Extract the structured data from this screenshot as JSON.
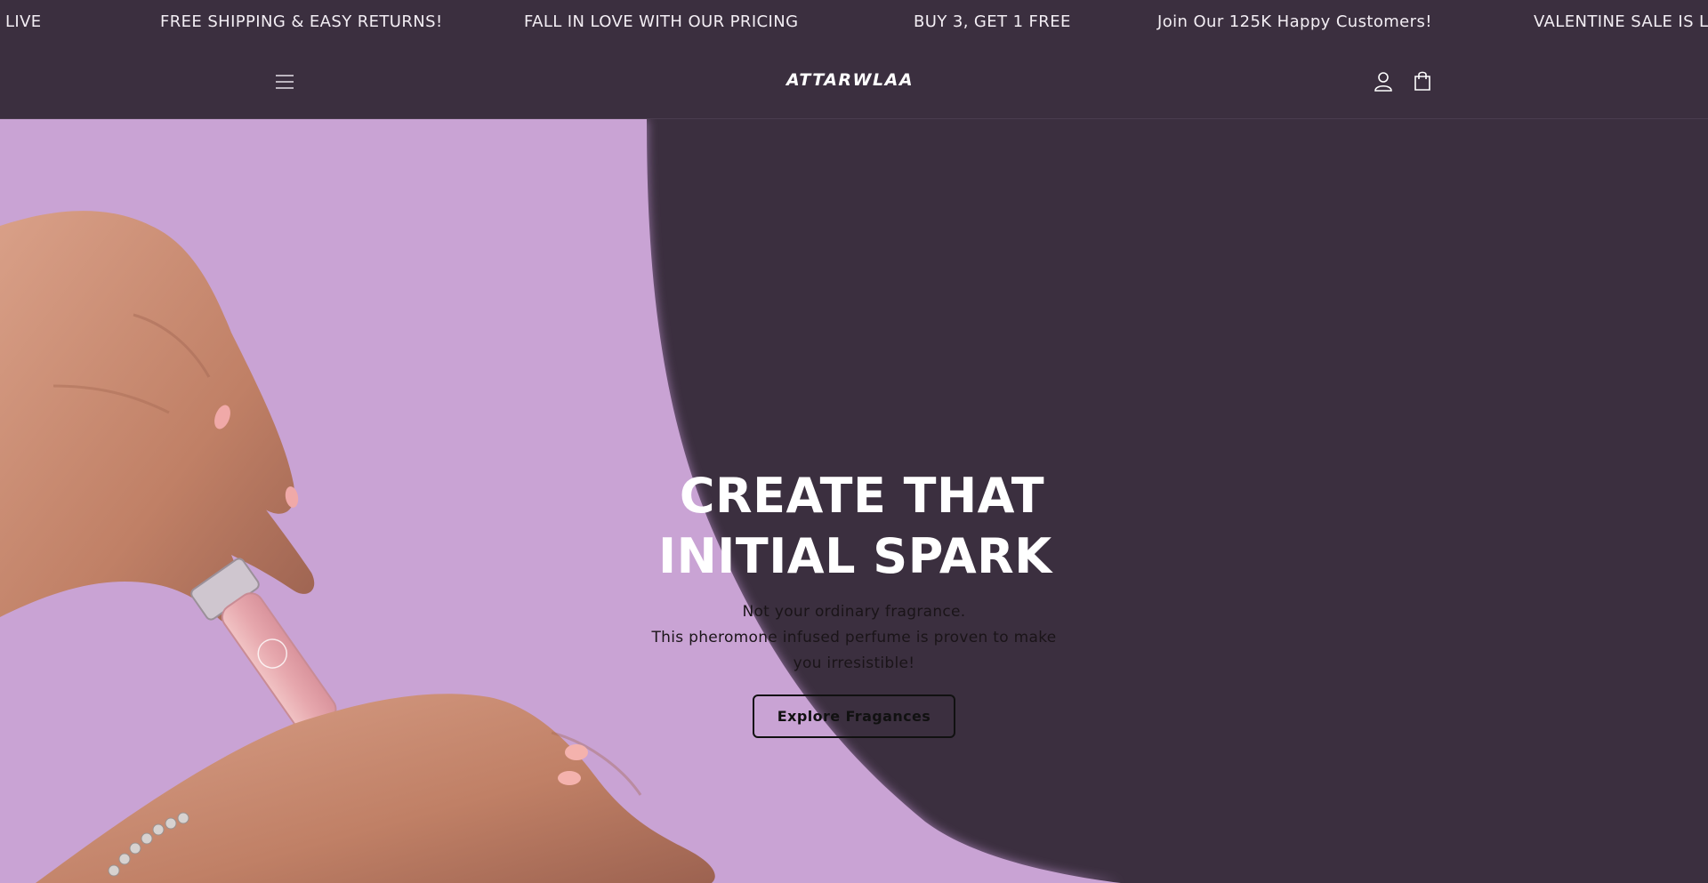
{
  "announcements": [
    "S LIVE",
    "FREE SHIPPING & EASY RETURNS!",
    "FALL IN LOVE WITH OUR PRICING",
    "BUY 3, GET 1 FREE",
    "Join Our 125K Happy Customers!",
    "VALENTINE SALE IS LI"
  ],
  "header": {
    "logo_text": "ATTARWLAA",
    "menu_icon": "hamburger-icon",
    "account_icon": "user-icon",
    "cart_icon": "shopping-bag-icon"
  },
  "hero": {
    "title_line1": "CREATE THAT",
    "title_line2": "INITIAL SPARK",
    "subtitle_line1": "Not your ordinary fragrance.",
    "subtitle_line2": "This pheromone infused perfume is proven to make",
    "subtitle_line3": "you irresistible!",
    "cta_label": "Explore Fragances",
    "image": "hand-applying-roll-on-perfume"
  },
  "colors": {
    "background": "#3b2f3f",
    "lilac": "#c9a3d4",
    "text_light": "#ffffff",
    "text_dark": "#111111"
  }
}
